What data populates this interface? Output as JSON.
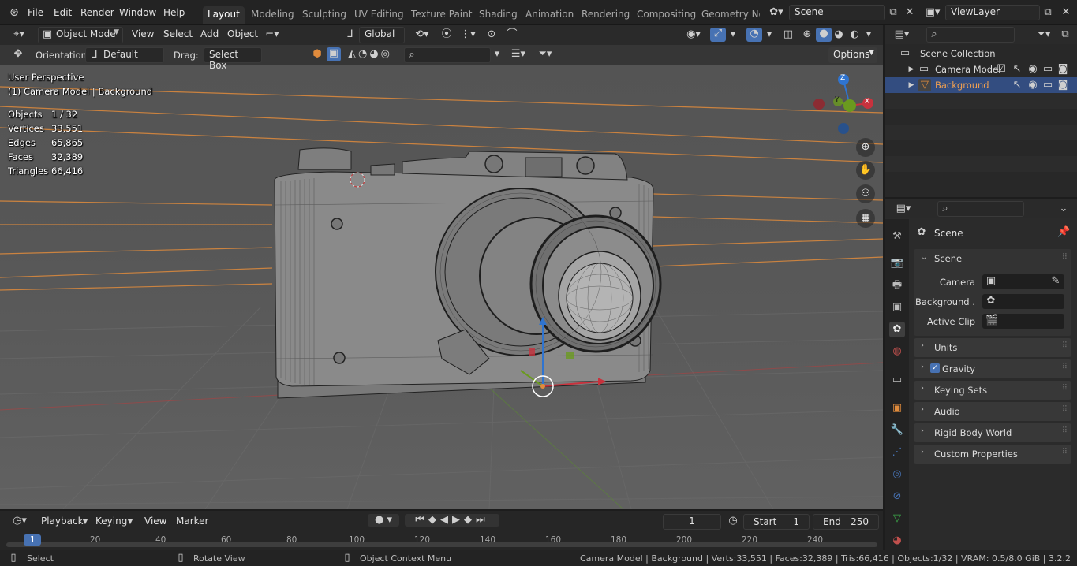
{
  "top_menu": {
    "items": [
      "File",
      "Edit",
      "Render",
      "Window",
      "Help"
    ],
    "workspace_tabs": [
      "Layout",
      "Modeling",
      "Sculpting",
      "UV Editing",
      "Texture Paint",
      "Shading",
      "Animation",
      "Rendering",
      "Compositing",
      "Geometry Noc"
    ],
    "scene_name": "Scene",
    "view_layer": "ViewLayer"
  },
  "viewport_header": {
    "mode": "Object Mode",
    "menus": [
      "View",
      "Select",
      "Add",
      "Object"
    ],
    "transform_orientation": "Global"
  },
  "tool_header": {
    "orientation_label": "Orientation:",
    "orientation_value": "Default",
    "drag_label": "Drag:",
    "drag_value": "Select Box",
    "options_label": "Options"
  },
  "viewport_overlay": {
    "view_name": "User Perspective",
    "context": "(1) Camera Model | Background",
    "stats": [
      {
        "label": "Objects",
        "value": "1 / 32"
      },
      {
        "label": "Vertices",
        "value": "33,551"
      },
      {
        "label": "Edges",
        "value": "65,865"
      },
      {
        "label": "Faces",
        "value": "32,389"
      },
      {
        "label": "Triangles",
        "value": "66,416"
      }
    ],
    "gizmo_axes": [
      "Z",
      "Y",
      "X"
    ]
  },
  "outliner": {
    "root": "Scene Collection",
    "items": [
      {
        "label": "Camera Model",
        "selected": false
      },
      {
        "label": "Background",
        "selected": true
      }
    ]
  },
  "properties": {
    "context_title": "Scene",
    "scene_panel": {
      "title": "Scene",
      "camera_label": "Camera",
      "background_label": "Background ...",
      "active_clip_label": "Active Clip"
    },
    "panels": [
      "Units",
      "Gravity",
      "Keying Sets",
      "Audio",
      "Rigid Body World",
      "Custom Properties"
    ]
  },
  "timeline": {
    "menus": [
      "Playback",
      "Keying",
      "View",
      "Marker"
    ],
    "current_frame": "1",
    "start_label": "Start",
    "start_value": "1",
    "end_label": "End",
    "end_value": "250",
    "ruler": [
      "1",
      "20",
      "40",
      "60",
      "80",
      "100",
      "120",
      "140",
      "160",
      "180",
      "200",
      "220",
      "240"
    ]
  },
  "statusbar": {
    "left_hint": "Select",
    "middle_hint": "Rotate View",
    "right_hint": "Object Context Menu",
    "stats": "Camera Model | Background | Verts:33,551 | Faces:32,389 | Tris:66,416 | Objects:1/32 | VRAM: 0.5/8.0 GiB | 3.2.2"
  },
  "colors": {
    "accent": "#4772b3",
    "selection": "#334d80",
    "x_axis": "#c8323d",
    "y_axis": "#6a9a1f",
    "z_axis": "#2f74d0",
    "background_orange": "#e08b3c"
  }
}
